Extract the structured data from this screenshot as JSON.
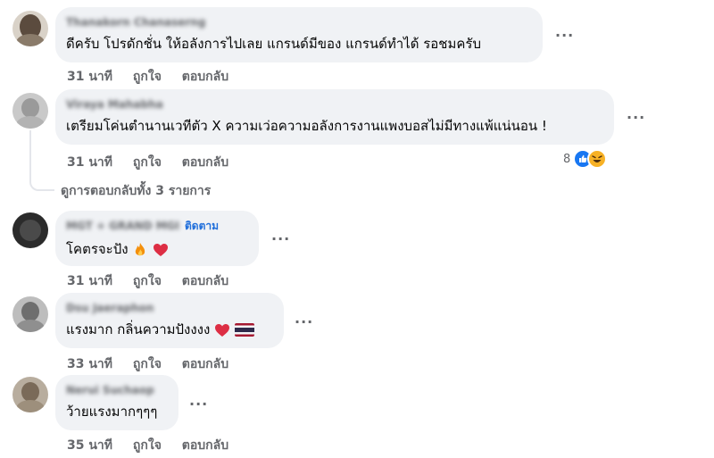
{
  "comments": [
    {
      "author": "Thanakorn Chanaserng",
      "text": "ดีครับ โปรดักชั่น ให้อลังการไปเลย แกรนด์มีของ แกรนด์ทำได้ รอชมครับ",
      "time": "31 นาที",
      "like_label": "ถูกใจ",
      "reply_label": "ตอบกลับ"
    },
    {
      "author": "Viraya Mahabha",
      "text": "เตรียมโค่นตำนานเวทีตัว X ความเว่อความอลังการงานแพงบอสไม่มีทางแพ้แน่นอน !",
      "time": "31 นาที",
      "like_label": "ถูกใจ",
      "reply_label": "ตอบกลับ",
      "reaction_count": "8",
      "view_replies": "ดูการตอบกลับทั้ง 3 รายการ"
    },
    {
      "author": "MGT + GRAND MGI",
      "follow_label": "ติดตาม",
      "text": "โคตรจะปัง",
      "time": "31 นาที",
      "like_label": "ถูกใจ",
      "reply_label": "ตอบกลับ"
    },
    {
      "author": "Dsu Jaeraphon",
      "text": "แรงมาก กลิ่นความปังงงง",
      "time": "33 นาที",
      "like_label": "ถูกใจ",
      "reply_label": "ตอบกลับ"
    },
    {
      "author": "Nerui Suchaop",
      "text": "ว้ายแรงมากๆๆๆ",
      "time": "35 นาที",
      "like_label": "ถูกใจ",
      "reply_label": "ตอบกลับ"
    }
  ],
  "more_label": "···",
  "colors": {
    "bubble": "#f0f2f5",
    "meta": "#65676b",
    "link": "#216fdb",
    "like": "#1877f2"
  }
}
